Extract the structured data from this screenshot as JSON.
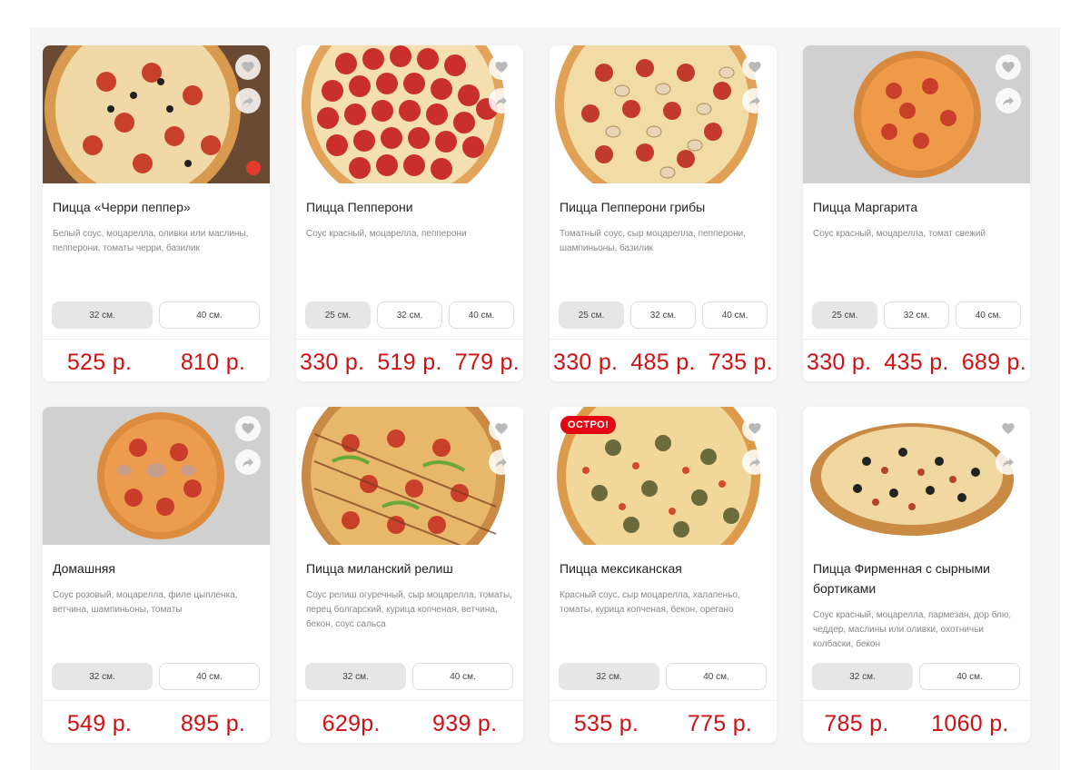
{
  "colors": {
    "price": "#d01012",
    "badge": "#e30613",
    "panel_bg": "#f5f5f5"
  },
  "cards": [
    {
      "name": "Пицца «Черри пеппер»",
      "description": "Белый соус, моцарелла, оливки или маслины, пепперони, томаты черри, базилик",
      "sizes": [
        "32 см.",
        "40 см."
      ],
      "active_size": 0,
      "prices": [
        "525 р.",
        "810 р."
      ],
      "icons": [
        "heart-icon",
        "share-icon"
      ]
    },
    {
      "name": "Пицца Пепперони",
      "description": "Соус красный, моцарелла, пепперони",
      "sizes": [
        "25 см.",
        "32 см.",
        "40 см."
      ],
      "active_size": 0,
      "prices": [
        "330 р.",
        "519 р.",
        "779 р."
      ],
      "icons": [
        "heart-icon",
        "share-icon"
      ]
    },
    {
      "name": "Пицца Пепперони грибы",
      "description": "Томатный соус, сыр моцарелла, пепперони, шампиньоны, базилик",
      "sizes": [
        "25 см.",
        "32 см.",
        "40 см."
      ],
      "active_size": 0,
      "prices": [
        "330 р.",
        "485 р.",
        "735 р."
      ],
      "icons": [
        "heart-icon",
        "share-icon"
      ]
    },
    {
      "name": "Пицца Маргарита",
      "description": "Соус красный, моцарелла, томат свежий",
      "sizes": [
        "25 см.",
        "32 см.",
        "40 см."
      ],
      "active_size": 0,
      "prices": [
        "330 р.",
        "435 р.",
        "689 р."
      ],
      "icons": [
        "heart-icon",
        "share-icon"
      ]
    },
    {
      "name": "Домашняя",
      "description": "Соус розовый, моцарелла, филе цыпленка, ветчина, шампиньоны, томаты",
      "sizes": [
        "32 см.",
        "40 см."
      ],
      "active_size": 0,
      "prices": [
        "549 р.",
        "895 р."
      ],
      "icons": [
        "heart-icon",
        "share-icon"
      ]
    },
    {
      "name": "Пицца миланский релиш",
      "description": "Соус релиш огуречный, сыр моцарелла, томаты, перец болгарский, курица копченая, ветчина, бекон, соус сальса",
      "sizes": [
        "32 см.",
        "40 см."
      ],
      "active_size": 0,
      "prices": [
        "629р.",
        "939 р."
      ],
      "icons": [
        "heart-icon",
        "share-icon"
      ]
    },
    {
      "name": "Пицца мексиканская",
      "description": "Красный соус, сыр моцарелла, халапеньо, томаты, курица копченая, бекон, орегано",
      "sizes": [
        "32 см.",
        "40 см."
      ],
      "active_size": 0,
      "prices": [
        "535 р.",
        "775 р."
      ],
      "badge": "ОСТРО!",
      "icons": [
        "heart-icon",
        "share-icon"
      ]
    },
    {
      "name": "Пицца Фирменная с сырными бортиками",
      "description": "Соус красный, моцарелла, пармезан, дор блю, чеддер, маслины или оливки, охотничьи колбаски, бекон",
      "sizes": [
        "32 см.",
        "40 см."
      ],
      "active_size": 0,
      "prices": [
        "785 р.",
        "1060 р."
      ],
      "icons": [
        "heart-icon",
        "share-icon"
      ]
    }
  ]
}
